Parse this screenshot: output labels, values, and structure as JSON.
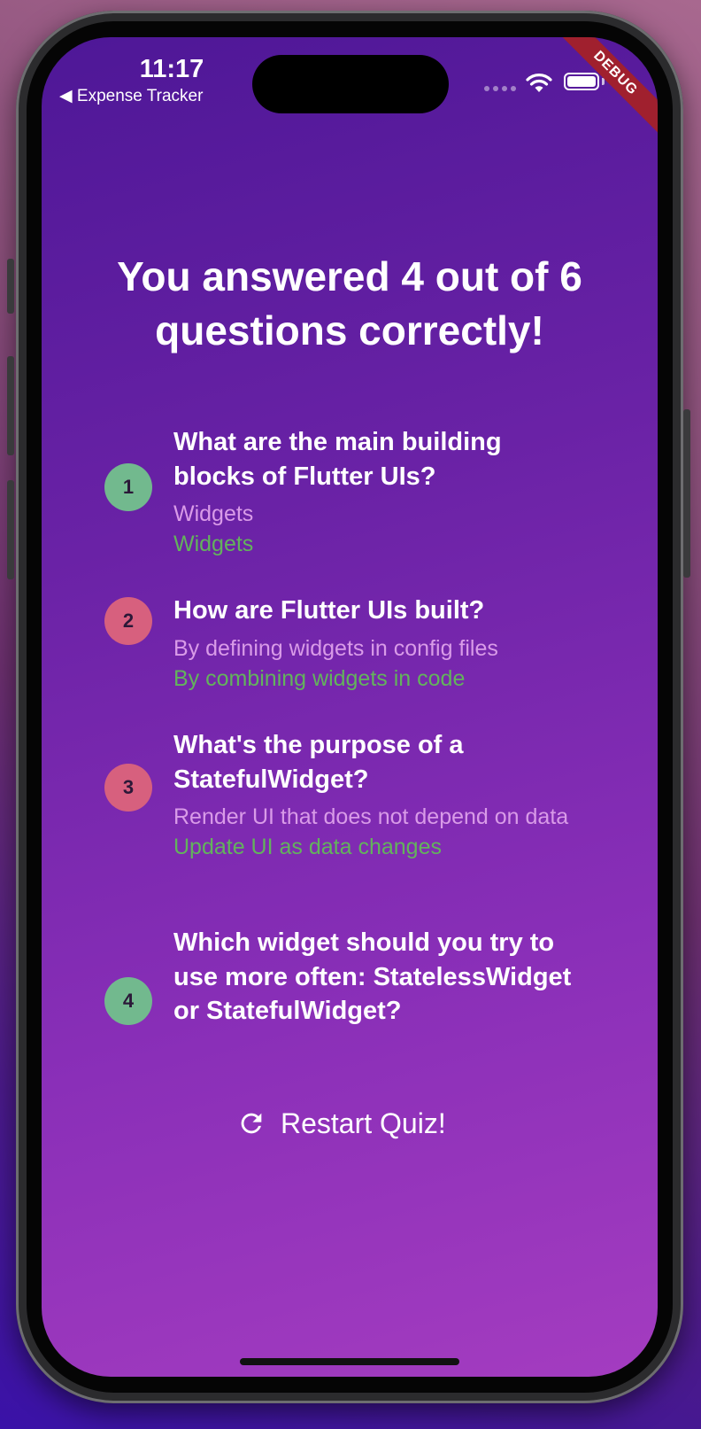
{
  "status_bar": {
    "time": "11:17",
    "back_label": "◀ Expense Tracker"
  },
  "debug_banner": "DEBUG",
  "result": {
    "title": "You answered 4 out of 6 questions correctly!"
  },
  "summary": [
    {
      "index": "1",
      "status": "correct",
      "question": "What are the main building blocks of Flutter UIs?",
      "user_answer": "Widgets",
      "correct_answer": "Widgets"
    },
    {
      "index": "2",
      "status": "wrong",
      "question": "How are Flutter UIs built?",
      "user_answer": "By defining widgets in config files",
      "correct_answer": "By combining widgets in code"
    },
    {
      "index": "3",
      "status": "wrong",
      "question": "What's the purpose of a StatefulWidget?",
      "user_answer": "Render UI that does not depend on data",
      "correct_answer": "Update UI as data changes"
    },
    {
      "index": "4",
      "status": "correct",
      "question": "Which widget should you try to use more often: StatelessWidget or StatefulWidget?",
      "user_answer": "",
      "correct_answer": ""
    }
  ],
  "restart_button": {
    "label": "Restart Quiz!",
    "icon": "refresh-icon"
  },
  "colors": {
    "correct_circle": "#72b98e",
    "wrong_circle": "#d7607e",
    "user_answer": "#d99be8",
    "correct_answer": "#63b35c",
    "debug_banner": "#a0202e"
  }
}
